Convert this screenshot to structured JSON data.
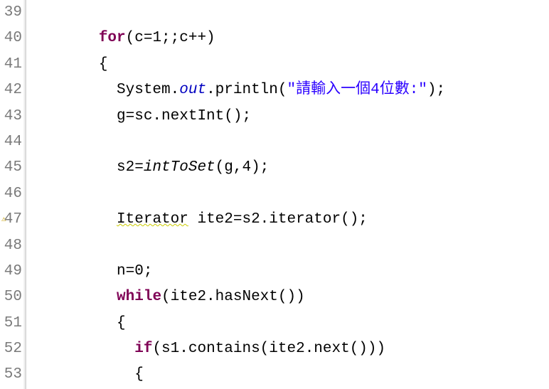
{
  "lines": [
    {
      "num": "39",
      "tokens": []
    },
    {
      "num": "40",
      "tokens": [
        {
          "cls": "tk-default",
          "text": "        "
        },
        {
          "cls": "tk-keyword",
          "text": "for"
        },
        {
          "cls": "tk-default",
          "text": "(c=1;;c++)"
        }
      ]
    },
    {
      "num": "41",
      "tokens": [
        {
          "cls": "tk-default",
          "text": "        {"
        }
      ]
    },
    {
      "num": "42",
      "tokens": [
        {
          "cls": "tk-default",
          "text": "          System."
        },
        {
          "cls": "tk-static-field",
          "text": "out"
        },
        {
          "cls": "tk-default",
          "text": ".println("
        },
        {
          "cls": "tk-string",
          "text": "\"請輸入一個4位數:\""
        },
        {
          "cls": "tk-default",
          "text": ");"
        }
      ]
    },
    {
      "num": "43",
      "tokens": [
        {
          "cls": "tk-default",
          "text": "          g=sc.nextInt();"
        }
      ]
    },
    {
      "num": "44",
      "tokens": []
    },
    {
      "num": "45",
      "tokens": [
        {
          "cls": "tk-default",
          "text": "          s2="
        },
        {
          "cls": "tk-static-call",
          "text": "intToSet"
        },
        {
          "cls": "tk-default",
          "text": "(g,4);"
        }
      ]
    },
    {
      "num": "46",
      "tokens": []
    },
    {
      "num": "47",
      "indicator": true,
      "tokens": [
        {
          "cls": "tk-default",
          "text": "          "
        },
        {
          "cls": "tk-default tk-warning",
          "text": "Iterator"
        },
        {
          "cls": "tk-default",
          "text": " ite2=s2.iterator();"
        }
      ]
    },
    {
      "num": "48",
      "tokens": []
    },
    {
      "num": "49",
      "tokens": [
        {
          "cls": "tk-default",
          "text": "          n=0;"
        }
      ]
    },
    {
      "num": "50",
      "tokens": [
        {
          "cls": "tk-default",
          "text": "          "
        },
        {
          "cls": "tk-keyword",
          "text": "while"
        },
        {
          "cls": "tk-default",
          "text": "(ite2.hasNext())"
        }
      ]
    },
    {
      "num": "51",
      "tokens": [
        {
          "cls": "tk-default",
          "text": "          {"
        }
      ]
    },
    {
      "num": "52",
      "tokens": [
        {
          "cls": "tk-default",
          "text": "            "
        },
        {
          "cls": "tk-keyword",
          "text": "if"
        },
        {
          "cls": "tk-default",
          "text": "(s1.contains(ite2.next()))"
        }
      ]
    },
    {
      "num": "53",
      "tokens": [
        {
          "cls": "tk-default",
          "text": "            {"
        }
      ]
    }
  ]
}
